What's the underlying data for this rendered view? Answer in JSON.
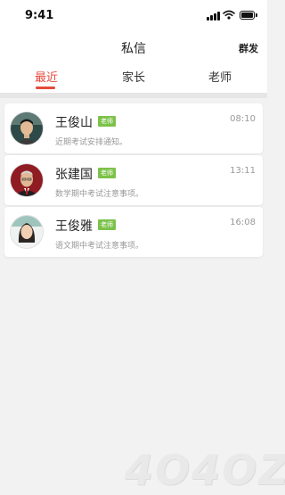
{
  "status_bar": {
    "time": "9:41"
  },
  "header": {
    "title": "私信",
    "action_label": "群发"
  },
  "tabs": [
    {
      "label": "最近",
      "active": true
    },
    {
      "label": "家长",
      "active": false
    },
    {
      "label": "老师",
      "active": false
    }
  ],
  "messages": [
    {
      "name": "王俊山",
      "badge": "老师",
      "time": "08:10",
      "preview": "近期考试安排通知。",
      "avatar": "male-teacher-avatar"
    },
    {
      "name": "张建国",
      "badge": "老师",
      "time": "13:11",
      "preview": "数学期中考试注意事项。",
      "avatar": "older-male-teacher-avatar"
    },
    {
      "name": "王俊雅",
      "badge": "老师",
      "time": "16:08",
      "preview": "语文期中考试注意事项。",
      "avatar": "female-teacher-avatar"
    }
  ],
  "colors": {
    "accent": "#e44b3c",
    "badge": "#7cc24a",
    "background": "#f2f2f2"
  },
  "watermark": "4O4OZ"
}
